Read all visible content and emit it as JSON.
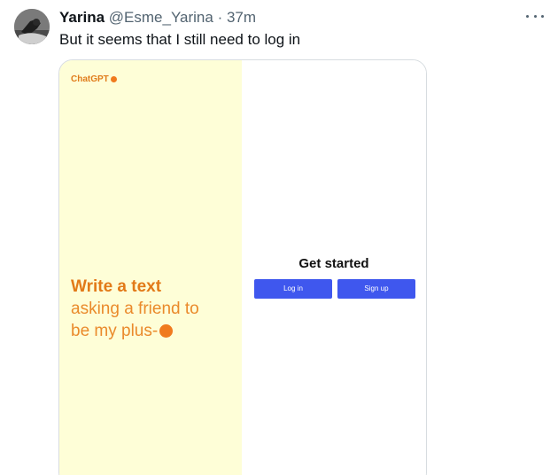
{
  "tweet": {
    "author_name": "Yarina",
    "author_handle": "@Esme_Yarina",
    "separator": "·",
    "time_ago": "37m",
    "text": "But it seems that I still need to log in",
    "more_icon": "more-horizontal-icon"
  },
  "screenshot": {
    "brand": "ChatGPT",
    "headline_bold": "Write a text",
    "headline_line2": "asking a friend to",
    "headline_line3": "be my plus-",
    "get_started": "Get started",
    "login_label": "Log in",
    "signup_label": "Sign up",
    "colors": {
      "left_bg": "#fefed7",
      "accent_orange": "#f07a1e",
      "button_blue": "#3f57ee"
    }
  }
}
